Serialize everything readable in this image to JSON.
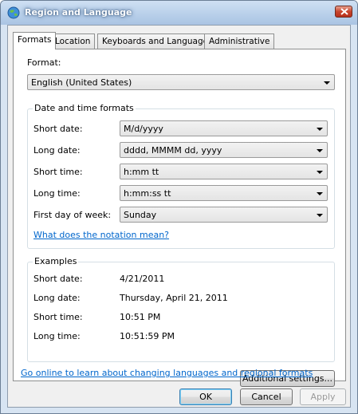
{
  "window": {
    "title": "Region and Language"
  },
  "tabs": [
    {
      "label": "Formats"
    },
    {
      "label": "Location"
    },
    {
      "label": "Keyboards and Languages"
    },
    {
      "label": "Administrative"
    }
  ],
  "format": {
    "label": "Format:",
    "value": "English (United States)"
  },
  "datetime_group": {
    "title": "Date and time formats",
    "rows": [
      {
        "label": "Short date:",
        "value": "M/d/yyyy"
      },
      {
        "label": "Long date:",
        "value": "dddd, MMMM dd, yyyy"
      },
      {
        "label": "Short time:",
        "value": "h:mm tt"
      },
      {
        "label": "Long time:",
        "value": "h:mm:ss tt"
      },
      {
        "label": "First day of week:",
        "value": "Sunday"
      }
    ],
    "notation_link": "What does the notation mean?"
  },
  "examples_group": {
    "title": "Examples",
    "rows": [
      {
        "label": "Short date:",
        "value": "4/21/2011"
      },
      {
        "label": "Long date:",
        "value": "Thursday, April 21, 2011"
      },
      {
        "label": "Short time:",
        "value": "10:51 PM"
      },
      {
        "label": "Long time:",
        "value": "10:51:59 PM"
      }
    ]
  },
  "additional_settings": "Additional settings...",
  "online_link": "Go online to learn about changing languages and regional formats",
  "buttons": {
    "ok": "OK",
    "cancel": "Cancel",
    "apply": "Apply"
  },
  "colors": {
    "link": "#0066cc",
    "title_bar": "#b9d0ea",
    "close": "#c7452d"
  },
  "icons": {
    "title": "globe-icon",
    "close": "close-icon"
  }
}
